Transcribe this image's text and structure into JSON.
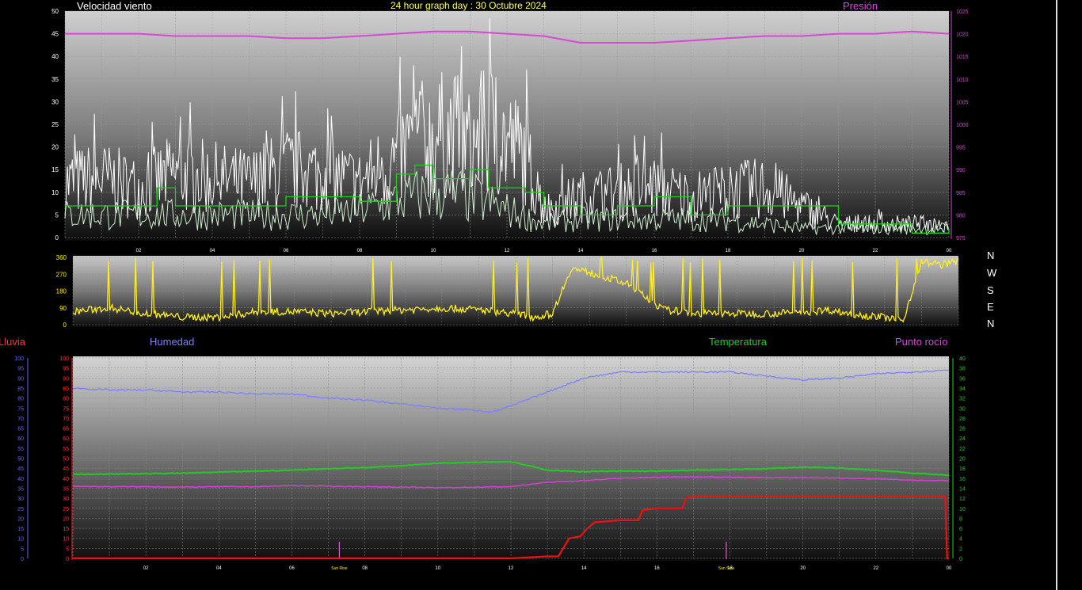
{
  "header": {
    "wind_title": "Velocidad viento",
    "date_title": "24 hour graph day : 30 Octubre 2024",
    "pressure_title": "Presión"
  },
  "compass": [
    "N",
    "W",
    "S",
    "E",
    "N"
  ],
  "lower_labels": {
    "rain": "Lluvia",
    "humidity": "Humedad",
    "temperature": "Temperatura",
    "dewpoint": "Punto rocío"
  },
  "sun_labels": {
    "sunrise": "Sun Rise",
    "sunset": "Sun Sets"
  },
  "colors": {
    "wind": "#ffffff",
    "wind_avg": "#cfeecf",
    "wind_dir_avg": "#22cc22",
    "pressure": "#dd44dd",
    "direction": "#ffee22",
    "humidity": "#7f7fff",
    "temperature": "#22cc22",
    "dewpoint": "#cc44cc",
    "rain": "#ee1111",
    "date": "#ffff66",
    "axis_red": "#ff3333",
    "axis_blue": "#6666ff",
    "axis_green": "#22cc22"
  },
  "chart_data": [
    {
      "type": "line",
      "title": "Velocidad viento",
      "x_ticks": [
        "02",
        "04",
        "06",
        "08",
        "10",
        "12",
        "14",
        "16",
        "18",
        "20",
        "22",
        "00"
      ],
      "xlim": [
        0,
        24
      ],
      "ylim": [
        0,
        50
      ],
      "y_ticks": [
        0,
        5,
        10,
        15,
        20,
        25,
        30,
        35,
        40,
        45,
        50
      ],
      "y2lim": [
        975,
        1025
      ],
      "y2_ticks": [
        975,
        980,
        985,
        990,
        995,
        1000,
        1005,
        1010,
        1015,
        1020,
        1025
      ],
      "grid": true,
      "series": [
        {
          "name": "Velocidad viento",
          "x": [
            0,
            1,
            2,
            3,
            4,
            5,
            6,
            7,
            8,
            8.5,
            9,
            9.5,
            10,
            10.5,
            11,
            11.5,
            12,
            12.5,
            13,
            14,
            15,
            16,
            17,
            18,
            19,
            20,
            21,
            22,
            23,
            24
          ],
          "y": [
            12,
            13,
            11,
            14,
            13,
            12,
            15,
            14,
            12,
            15,
            17,
            21,
            22,
            23,
            20,
            24,
            21,
            18,
            6,
            9,
            10,
            11,
            9,
            10,
            11,
            7,
            3,
            3,
            3,
            3
          ]
        },
        {
          "x": [
            0,
            1,
            2,
            3,
            4,
            5,
            6,
            7,
            8,
            9,
            10,
            11,
            12,
            13,
            14,
            15,
            16,
            17,
            18,
            19,
            20,
            21,
            22,
            23,
            24
          ],
          "y": [
            5,
            5,
            5,
            5,
            5,
            5,
            5,
            5,
            6,
            8,
            10,
            9,
            6,
            3,
            4,
            4,
            4,
            4,
            4,
            3,
            2,
            2,
            2,
            2,
            2
          ]
        },
        {
          "x": [
            0,
            0.5,
            1,
            2,
            2.5,
            3,
            4,
            5,
            6,
            7,
            8,
            9,
            9.5,
            10,
            11,
            11.5,
            12,
            12.5,
            13,
            14,
            15,
            16,
            17,
            18,
            19,
            20,
            21,
            22,
            23,
            24
          ],
          "y": [
            7,
            7,
            7,
            7,
            11,
            7,
            7,
            7,
            9,
            9,
            8,
            14,
            16,
            13,
            15,
            11,
            11,
            10,
            7,
            5,
            7,
            9,
            5,
            7,
            7,
            7,
            3,
            3,
            1,
            2
          ]
        },
        {
          "name": "Presión",
          "axis": "right",
          "x": [
            0,
            1,
            2,
            3,
            4,
            5,
            6,
            7,
            8,
            9,
            10,
            10.5,
            11,
            12,
            13,
            14,
            15,
            16,
            17,
            18,
            19,
            20,
            21,
            22,
            23,
            24
          ],
          "y": [
            1020,
            1020,
            1020,
            1019.5,
            1019.5,
            1019.5,
            1019,
            1019,
            1019.5,
            1020,
            1020.5,
            1020.5,
            1020.5,
            1020,
            1019.5,
            1018,
            1018,
            1018,
            1018.5,
            1019,
            1019.5,
            1019.5,
            1020,
            1020,
            1020.5,
            1020
          ]
        }
      ]
    },
    {
      "type": "line",
      "title": "",
      "xlim": [
        0,
        24
      ],
      "ylim": [
        0,
        360
      ],
      "y_ticks": [
        0,
        90,
        180,
        270,
        360
      ],
      "series": [
        {
          "name": "Dirección",
          "x": [
            0,
            1,
            2,
            3,
            4,
            5,
            6,
            7,
            8,
            9,
            10,
            11,
            12,
            12.5,
            13,
            13.5,
            14,
            15,
            15.5,
            16,
            17,
            18,
            19,
            20,
            20.5,
            21,
            22,
            22.5,
            23,
            23.5,
            24
          ],
          "y": [
            70,
            90,
            60,
            40,
            40,
            70,
            70,
            60,
            70,
            80,
            90,
            80,
            60,
            40,
            60,
            300,
            280,
            220,
            150,
            80,
            60,
            60,
            60,
            70,
            80,
            60,
            40,
            20,
            340,
            320,
            340
          ]
        }
      ]
    },
    {
      "type": "line",
      "title": "",
      "x_ticks": [
        "02",
        "04",
        "06",
        "08",
        "10",
        "12",
        "14",
        "16",
        "18",
        "20",
        "22",
        "00"
      ],
      "xlim": [
        0,
        24
      ],
      "ylim": [
        0,
        100
      ],
      "y_ticks": [
        0,
        5,
        10,
        15,
        20,
        25,
        30,
        35,
        40,
        45,
        50,
        55,
        60,
        65,
        70,
        75,
        80,
        85,
        90,
        95,
        100
      ],
      "y_left2_ticks": [
        0,
        5,
        10,
        15,
        20,
        25,
        30,
        35,
        40,
        45,
        50,
        55,
        60,
        65,
        70,
        75,
        80,
        85,
        90,
        95,
        100
      ],
      "y_right_lim": [
        0,
        40
      ],
      "y_right_ticks": [
        0,
        2,
        4,
        6,
        8,
        10,
        12,
        14,
        16,
        18,
        20,
        22,
        24,
        26,
        28,
        30,
        32,
        34,
        36,
        38,
        40
      ],
      "grid": true,
      "series": [
        {
          "name": "Humedad",
          "x": [
            0,
            1,
            2,
            3,
            4,
            5,
            6,
            7,
            8,
            9,
            10,
            11,
            11.5,
            12,
            13,
            14,
            15,
            16,
            17,
            18,
            19,
            20,
            21,
            22,
            23,
            24
          ],
          "y": [
            85,
            84,
            84,
            83,
            83,
            82,
            82,
            80,
            79,
            77,
            75,
            74,
            73,
            76,
            83,
            90,
            93,
            93,
            93,
            93,
            91,
            89,
            90,
            92,
            93,
            94
          ]
        },
        {
          "name": "Temperatura",
          "axis": "right",
          "x": [
            0,
            1,
            2,
            3,
            4,
            5,
            6,
            7,
            8,
            9,
            10,
            11,
            12,
            13,
            14,
            15,
            16,
            17,
            18,
            19,
            20,
            21,
            22,
            23,
            24
          ],
          "y": [
            16.8,
            16.8,
            16.9,
            17,
            17.2,
            17.4,
            17.6,
            17.9,
            18.1,
            18.5,
            19,
            19.2,
            19.3,
            17.6,
            17.3,
            17.4,
            17.4,
            17.6,
            17.7,
            17.9,
            18.2,
            18,
            17.6,
            17,
            16.6
          ]
        },
        {
          "name": "Punto rocío",
          "axis": "right",
          "x": [
            0,
            1,
            2,
            3,
            4,
            5,
            6,
            7,
            8,
            9,
            10,
            11,
            12,
            13,
            14,
            15,
            16,
            17,
            18,
            19,
            20,
            21,
            22,
            23,
            24
          ],
          "y": [
            14.4,
            14.3,
            14.3,
            14.2,
            14.3,
            14.3,
            14.5,
            14.4,
            14.3,
            14.2,
            14.1,
            14.2,
            14.3,
            15.2,
            15.5,
            16,
            16.2,
            16.3,
            16.2,
            16.1,
            16.1,
            16,
            15.9,
            15.6,
            15.5
          ]
        },
        {
          "name": "Lluvia",
          "x": [
            0,
            12,
            13,
            13.3,
            13.6,
            13.9,
            14.1,
            14.3,
            15,
            15.5,
            15.6,
            16,
            16.7,
            16.8,
            17,
            23.9,
            23.95,
            24
          ],
          "y": [
            0,
            0,
            1,
            1,
            10,
            11,
            15,
            18,
            19,
            19,
            24,
            25,
            25,
            30,
            31,
            31,
            0,
            0
          ]
        }
      ]
    }
  ]
}
